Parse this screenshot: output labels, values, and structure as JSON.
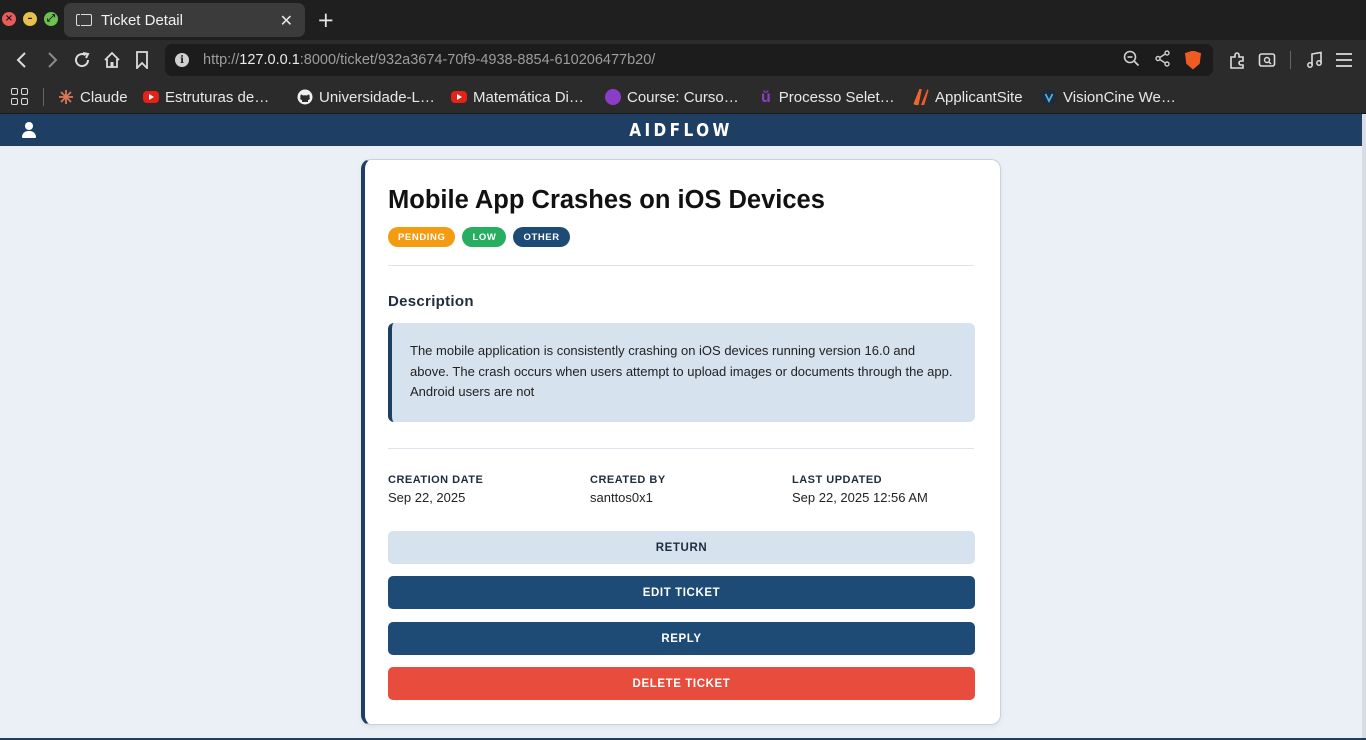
{
  "browser": {
    "tab_title": "Ticket Detail",
    "url_scheme": "http://",
    "url_host": "127.0.0.1",
    "url_rest": ":8000/ticket/932a3674-70f9-4938-8854-610206477b20/",
    "bookmarks": [
      {
        "label": "Claude",
        "icon": "claude-icon"
      },
      {
        "label": "Estruturas de…",
        "icon": "youtube-icon"
      },
      {
        "label": "Universidade-L…",
        "icon": "github-icon"
      },
      {
        "label": "Matemática Di…",
        "icon": "youtube-icon"
      },
      {
        "label": "Course: Curso…",
        "icon": "udemy-icon"
      },
      {
        "label": "Processo Selet…",
        "icon": "udemy-icon"
      },
      {
        "label": "ApplicantSite",
        "icon": "applicantsite-icon"
      },
      {
        "label": "VisionCine We…",
        "icon": "visioncine-icon"
      }
    ]
  },
  "app": {
    "brand": "AIDFLOW",
    "colors": {
      "primary": "#1e3f63",
      "pending": "#f39c12",
      "low": "#27ae60",
      "other": "#1e4a76",
      "danger": "#e74c3c"
    }
  },
  "ticket": {
    "title": "Mobile App Crashes on iOS Devices",
    "badges": {
      "status": "PENDING",
      "priority": "LOW",
      "category": "OTHER"
    },
    "description_heading": "Description",
    "description": "The mobile application is consistently crashing on iOS devices running version 16.0 and above. The crash occurs when users attempt to upload images or documents through the app. Android users are not",
    "meta": {
      "creation_label": "CREATION DATE",
      "creation_value": "Sep 22, 2025",
      "created_by_label": "CREATED BY",
      "created_by_value": "santtos0x1",
      "updated_label": "LAST UPDATED",
      "updated_value": "Sep 22, 2025 12:56 AM"
    },
    "actions": {
      "return": "RETURN",
      "edit": "EDIT TICKET",
      "reply": "REPLY",
      "delete": "DELETE TICKET"
    }
  }
}
